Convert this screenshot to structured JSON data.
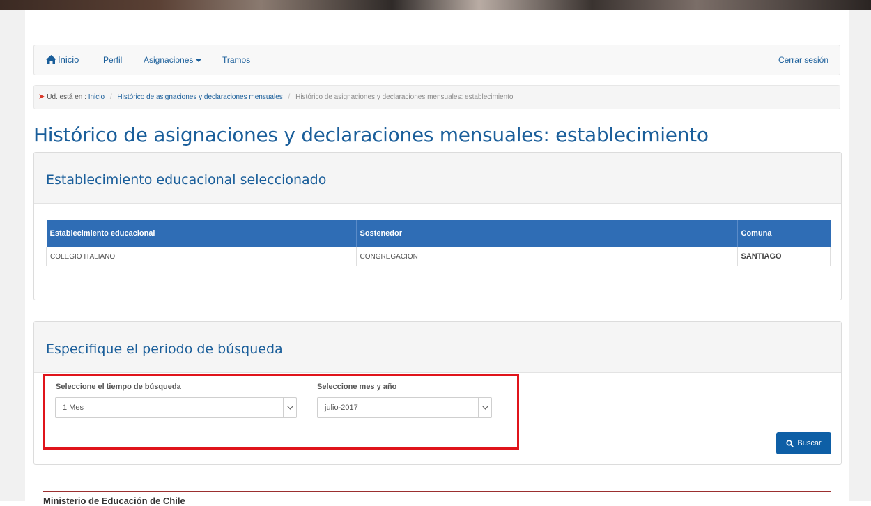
{
  "navbar": {
    "home": "Inicio",
    "perfil": "Perfil",
    "asignaciones": "Asignaciones",
    "tramos": "Tramos",
    "logout": "Cerrar sesión"
  },
  "breadcrumb": {
    "prefix": "Ud. está en :",
    "items": [
      "Inicio",
      "Histórico de asignaciones y declaraciones mensuales",
      "Histórico de asignaciones y declaraciones mensuales: establecimiento"
    ]
  },
  "page_title": "Histórico de asignaciones y declaraciones mensuales: establecimiento",
  "panel_establishment": {
    "heading": "Establecimiento educacional seleccionado",
    "columns": [
      "Establecimiento educacional",
      "Sostenedor",
      "Comuna"
    ],
    "rows": [
      [
        "COLEGIO ITALIANO",
        "CONGREGACION",
        "SANTIAGO"
      ]
    ]
  },
  "panel_search": {
    "heading": "Especifique el periodo de búsqueda",
    "time_label": "Seleccione el tiempo de búsqueda",
    "time_value": "1 Mes",
    "month_label": "Seleccione mes y año",
    "month_value": "julio-2017",
    "button": "Buscar"
  },
  "footer": {
    "text": "Ministerio de Educación de Chile"
  },
  "colors": {
    "primary": "#1a5e9a",
    "table_header": "#2f6db5",
    "button": "#0e5fa6",
    "highlight": "#e0141b"
  }
}
